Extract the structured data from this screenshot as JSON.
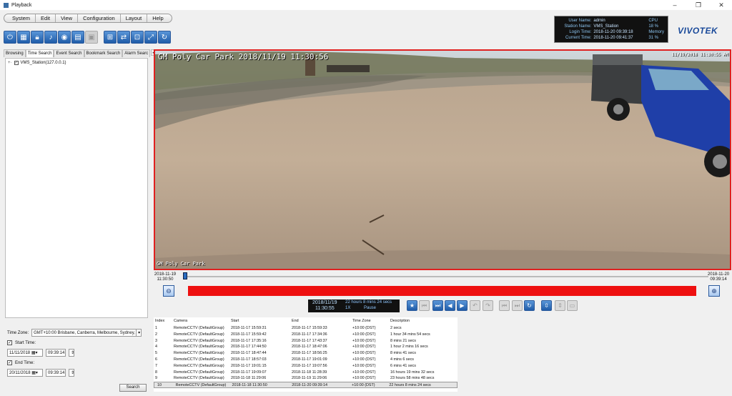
{
  "window": {
    "title": "Playback"
  },
  "menu": [
    "System",
    "Edit",
    "View",
    "Configuration",
    "Layout",
    "Help"
  ],
  "toolbar": {
    "buttons": [
      "power-icon",
      "layout-icon",
      "lock-icon",
      "volume-icon",
      "snapshot-icon",
      "print-icon",
      "export-icon",
      "grid-icon",
      "camera-link-icon",
      "split-icon",
      "fullscreen-icon",
      "refresh-icon"
    ]
  },
  "info": {
    "user_label": "User Name:",
    "user_value": "admin",
    "station_label": "Station Name:",
    "station_value": "VMS_Station",
    "login_label": "Login Time:",
    "login_value": "2018-11-20 09:39:18",
    "current_label": "Current Time:",
    "current_value": "2018-11-20 09:41:37",
    "cpu_label": "CPU",
    "cpu_value": "18 %",
    "memory_label": "Memory",
    "memory_value": "31 %"
  },
  "brand": {
    "logo": "VIVOTEK"
  },
  "tabs": [
    "Browsing",
    "Time Search",
    "Event Search",
    "Bookmark Search",
    "Alarm Searc"
  ],
  "tree": {
    "root": "VMS_Station(127.0.0.1)"
  },
  "search": {
    "timezone_label": "Time Zone:",
    "timezone_value": "GMT+10:00 Brisbane, Canberra, Melbourne, Sydney, Gua",
    "start_label": "Start Time:",
    "start_date": "11/11/2018",
    "start_time": "09:39:14",
    "end_label": "End Time:",
    "end_date": "20/11/2018",
    "end_time": "09:39:14",
    "search_button": "Search"
  },
  "video": {
    "osd_title": "GM Poly Car Park 2018/11/19 11:30:56",
    "osd_right": "11/19/2018  11:30:55 AM",
    "osd_bottom": "GM Poly Car Park"
  },
  "timeline": {
    "start_date": "2018-11-19",
    "start_time": "11:30:50",
    "end_date": "2018-11-20",
    "end_time": "09:39:14",
    "position": 0.0
  },
  "playback": {
    "date": "2018/11/19",
    "time": "11:30:55",
    "duration": "22 hours 8 mins 24 secs",
    "speed": "1X",
    "state": "Pause"
  },
  "table": {
    "headers": [
      "Index",
      "Camera",
      "Start",
      "End",
      "Time Zone",
      "Description"
    ],
    "rows": [
      [
        "1",
        "RemoteCCTV (DefaultGroup)",
        "2018-11-17 15:59:31",
        "2018-11-17 15:59:33",
        "+10:00 (DST)",
        "2 secs"
      ],
      [
        "2",
        "RemoteCCTV (DefaultGroup)",
        "2018-11-17 15:59:42",
        "2018-11-17 17:34:36",
        "+10:00 (DST)",
        "1 hour 34 mins 54 secs"
      ],
      [
        "3",
        "RemoteCCTV (DefaultGroup)",
        "2018-11-17 17:35:16",
        "2018-11-17 17:43:37",
        "+10:00 (DST)",
        "8 mins 21 secs"
      ],
      [
        "4",
        "RemoteCCTV (DefaultGroup)",
        "2018-11-17 17:44:50",
        "2018-11-17 18:47:06",
        "+10:00 (DST)",
        "1 hour 2 mins 16 secs"
      ],
      [
        "5",
        "RemoteCCTV (DefaultGroup)",
        "2018-11-17 18:47:44",
        "2018-11-17 18:56:25",
        "+10:00 (DST)",
        "8 mins 41 secs"
      ],
      [
        "6",
        "RemoteCCTV (DefaultGroup)",
        "2018-11-17 18:57:03",
        "2018-11-17 19:01:09",
        "+10:00 (DST)",
        "4 mins 6 secs"
      ],
      [
        "7",
        "RemoteCCTV (DefaultGroup)",
        "2018-11-17 19:01:15",
        "2018-11-17 19:07:56",
        "+10:00 (DST)",
        "6 mins 41 secs"
      ],
      [
        "8",
        "RemoteCCTV (DefaultGroup)",
        "2018-11-17 19:09:07",
        "2018-11-18 11:28:39",
        "+10:00 (DST)",
        "16 hours 19 mins 32 secs"
      ],
      [
        "9",
        "RemoteCCTV (DefaultGroup)",
        "2018-11-18 11:29:06",
        "2018-11-19 11:29:06",
        "+10:00 (DST)",
        "23 hours 58 mins 48 secs"
      ],
      [
        "10",
        "RemoteCCTV (DefaultGroup)",
        "2018-11-18 11:30:50",
        "2018-11-20 09:39:14",
        "+10:00 (DST)",
        "22 hours 8 mins 24 secs"
      ]
    ]
  }
}
